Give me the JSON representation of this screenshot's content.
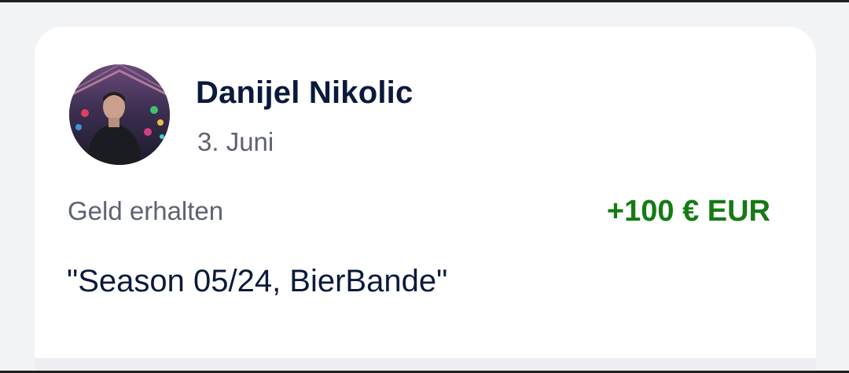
{
  "transaction": {
    "sender_name": "Danijel Nikolic",
    "date": "3. Juni",
    "type_label": "Geld erhalten",
    "amount": "+100 € EUR",
    "reference": "\"Season 05/24, BierBande\""
  },
  "avatar": {
    "icon": "profile-photo"
  },
  "colors": {
    "name": "#0b1a3b",
    "secondary_text": "#5d6370",
    "amount_positive": "#157a15",
    "card_background": "#ffffff",
    "page_background": "#f2f3f5"
  }
}
